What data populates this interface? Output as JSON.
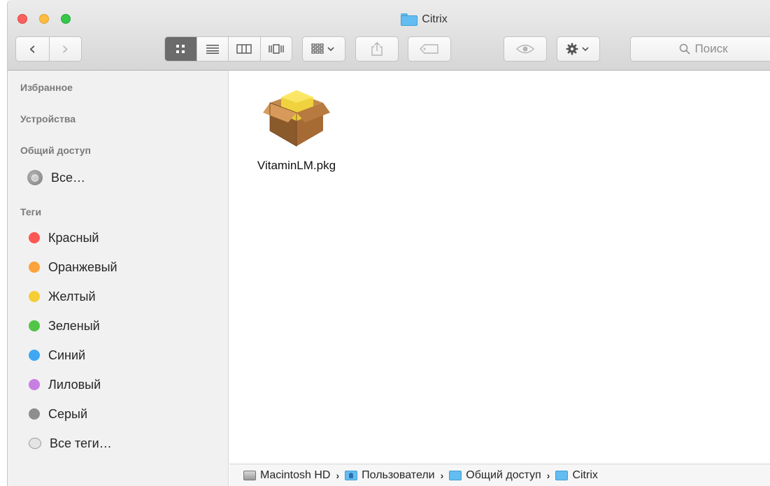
{
  "window": {
    "title": "Citrix"
  },
  "toolbar": {
    "back_icon": "chevron-left-icon",
    "forward_icon": "chevron-right-icon",
    "view_modes": [
      "icon-view",
      "list-view",
      "column-view",
      "cover-flow-view"
    ],
    "arrange_icon": "arrange-grid-icon",
    "share_icon": "share-icon",
    "tag_icon": "tag-icon",
    "quicklook_icon": "eye-icon",
    "action_icon": "gear-icon",
    "search_placeholder": "Поиск"
  },
  "sidebar": {
    "favorites_header": "Избранное",
    "devices_header": "Устройства",
    "shared_header": "Общий доступ",
    "shared_all": "Все…",
    "tags_header": "Теги",
    "tags": [
      {
        "label": "Красный",
        "color": "#fc5753"
      },
      {
        "label": "Оранжевый",
        "color": "#fca33c"
      },
      {
        "label": "Желтый",
        "color": "#f5ce37"
      },
      {
        "label": "Зеленый",
        "color": "#52c548"
      },
      {
        "label": "Синий",
        "color": "#3fa8f4"
      },
      {
        "label": "Лиловый",
        "color": "#c77fe2"
      },
      {
        "label": "Серый",
        "color": "#8e8e8e"
      }
    ],
    "all_tags": "Все теги…"
  },
  "content": {
    "files": [
      {
        "name": "VitaminLM.pkg",
        "icon": "package-icon"
      }
    ]
  },
  "pathbar": {
    "items": [
      "Macintosh HD",
      "Пользователи",
      "Общий доступ",
      "Citrix"
    ]
  }
}
